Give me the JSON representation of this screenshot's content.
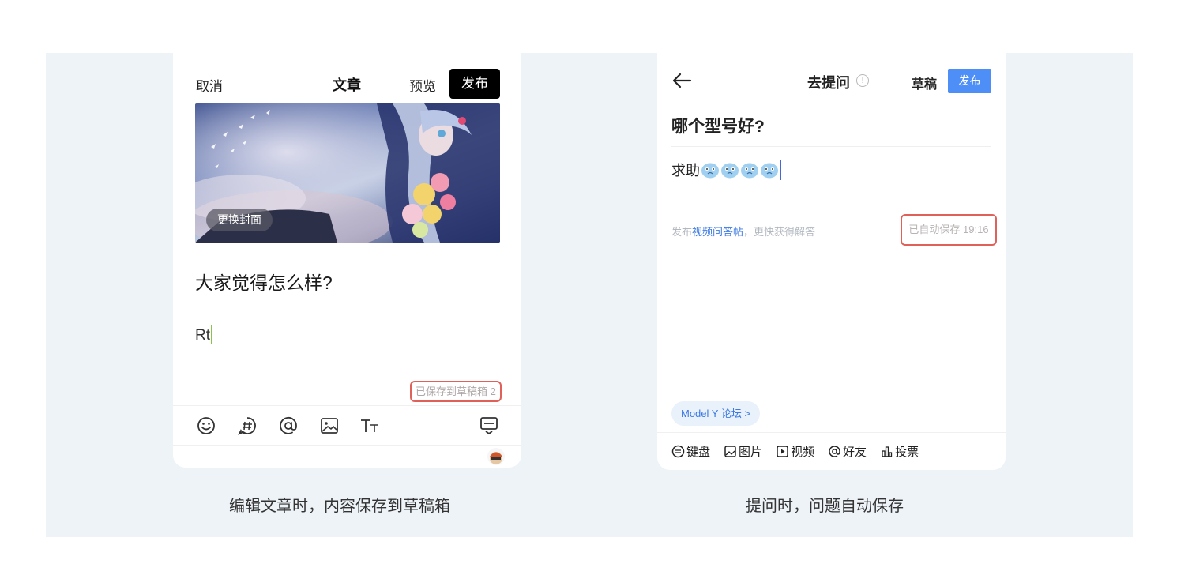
{
  "left": {
    "header": {
      "cancel": "取消",
      "title": "文章",
      "preview": "预览",
      "publish": "发布"
    },
    "cover": {
      "change_label": "更换封面"
    },
    "title_text": "大家觉得怎么样?",
    "body_text": "Rt",
    "saved_text": "已保存到草稿箱 2",
    "toolbar": [
      "smile-icon",
      "topic-hash-icon",
      "at-icon",
      "image-icon",
      "text-style-icon",
      "keyboard-collapse-icon"
    ],
    "caption": "编辑文章时，内容保存到草稿箱"
  },
  "right": {
    "header": {
      "title": "去提问",
      "info": "!",
      "draft": "草稿",
      "publish": "发布"
    },
    "question": "哪个型号好?",
    "body_text": "求助",
    "hint": {
      "prefix": "发布",
      "link": "视频问答帖",
      "suffix": "，更快获得解答"
    },
    "saved_text": "已自动保存 19:16",
    "forum_chip": "Model Y 论坛 >",
    "toolbar": {
      "keyboard": "键盘",
      "image": "图片",
      "video": "视频",
      "friend": "好友",
      "vote": "投票"
    },
    "caption": "提问时，问题自动保存"
  },
  "colors": {
    "background": "#eef3f8",
    "highlight_border": "#e0605a",
    "accent_blue": "#4e8ef7",
    "link_blue": "#3d7ae3"
  }
}
